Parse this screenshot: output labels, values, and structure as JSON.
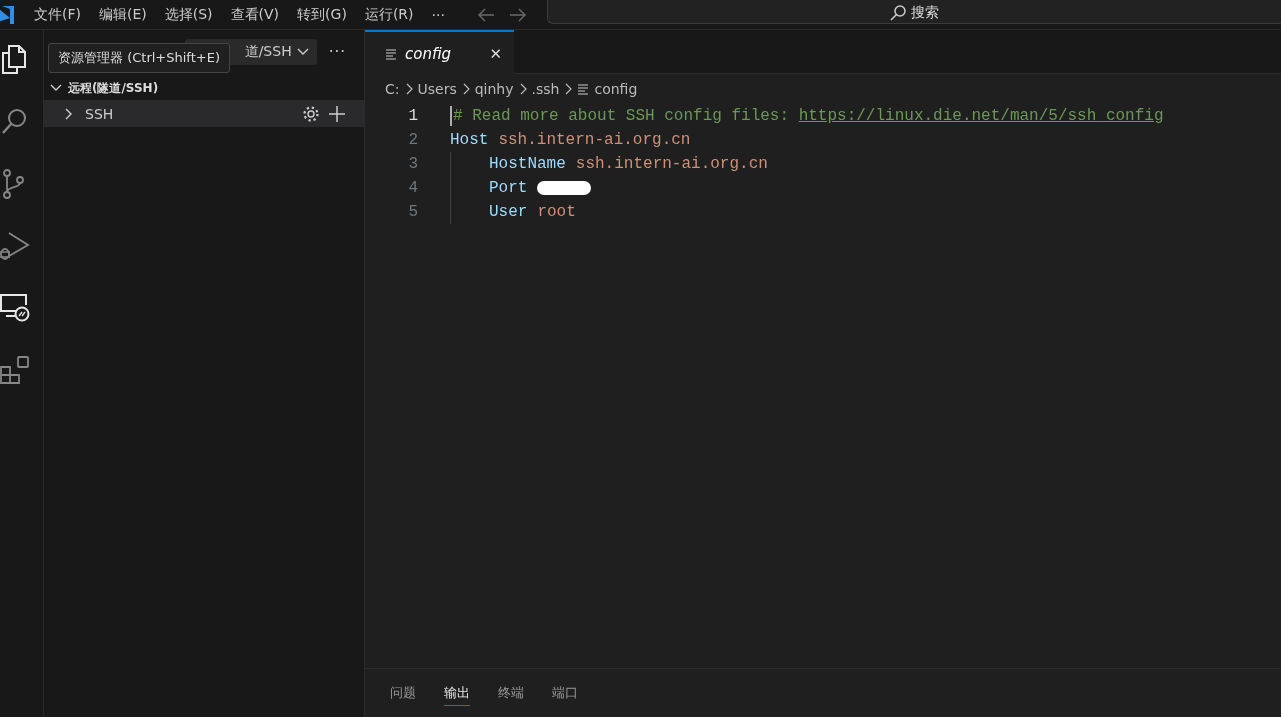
{
  "title_bar": {
    "menus": [
      "文件(F)",
      "编辑(E)",
      "选择(S)",
      "查看(V)",
      "转到(G)",
      "运行(R)",
      "···"
    ],
    "search": {
      "placeholder": "搜索"
    }
  },
  "activity_bar": {
    "items": [
      {
        "kind": "explorer",
        "highlighted": true
      },
      {
        "kind": "search",
        "highlighted": false
      },
      {
        "kind": "source-control",
        "highlighted": false
      },
      {
        "kind": "run-debug",
        "highlighted": false
      },
      {
        "kind": "remote",
        "highlighted": true
      },
      {
        "kind": "extensions",
        "highlighted": false
      }
    ]
  },
  "tooltip": {
    "text": "资源管理器 (Ctrl+Shift+E)"
  },
  "sidebar": {
    "view_picker": "道/SSH",
    "more": "···",
    "section": {
      "title": "远程(隧道/SSH)",
      "expanded": true,
      "items": [
        {
          "label": "SSH",
          "expanded": false,
          "selected": true
        }
      ]
    }
  },
  "editor": {
    "tabs": [
      {
        "label": "config",
        "selected": true,
        "close": "✕"
      }
    ],
    "breadcrumb": [
      "C:",
      "Users",
      "qinhy",
      ".ssh",
      "config"
    ],
    "lines": [
      {
        "number": "1",
        "active": true,
        "indented": false,
        "tokens": [
          {
            "kind": "comment",
            "text": "# Read more about SSH config files: "
          },
          {
            "kind": "link",
            "text": "https://linux.die.net/man/5/ssh_config"
          }
        ]
      },
      {
        "number": "2",
        "active": false,
        "indented": false,
        "tokens": [
          {
            "kind": "keyword",
            "text": "Host"
          },
          {
            "kind": "value",
            "text": "ssh.intern-ai.org.cn"
          }
        ]
      },
      {
        "number": "3",
        "active": false,
        "indented": true,
        "tokens": [
          {
            "kind": "keyword",
            "text": "HostName"
          },
          {
            "kind": "value",
            "text": "ssh.intern-ai.org.cn"
          }
        ]
      },
      {
        "number": "4",
        "active": false,
        "indented": true,
        "tokens": [
          {
            "kind": "keyword",
            "text": "Port"
          },
          {
            "kind": "redacted"
          }
        ]
      },
      {
        "number": "5",
        "active": false,
        "indented": true,
        "tokens": [
          {
            "kind": "keyword",
            "text": "User"
          },
          {
            "kind": "value",
            "text": "root"
          }
        ]
      }
    ]
  },
  "panel": {
    "tabs": [
      {
        "label": "问题",
        "selected": false
      },
      {
        "label": "输出",
        "selected": true
      },
      {
        "label": "终端",
        "selected": false
      },
      {
        "label": "端口",
        "selected": false
      }
    ]
  }
}
